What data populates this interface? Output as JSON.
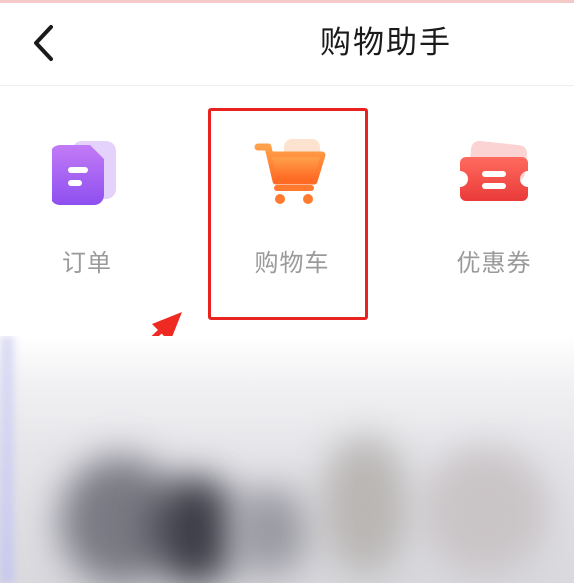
{
  "header": {
    "title": "购物助手",
    "back_icon": "chevron-left-icon"
  },
  "tools": [
    {
      "label": "订单",
      "icon": "order-document-icon",
      "color": "#9b59f0"
    },
    {
      "label": "购物车",
      "icon": "shopping-cart-icon",
      "color": "#ff7a2e"
    },
    {
      "label": "优惠券",
      "icon": "coupon-ticket-icon",
      "color": "#f24545"
    }
  ],
  "annotation": {
    "highlight_color": "#e8231f"
  }
}
